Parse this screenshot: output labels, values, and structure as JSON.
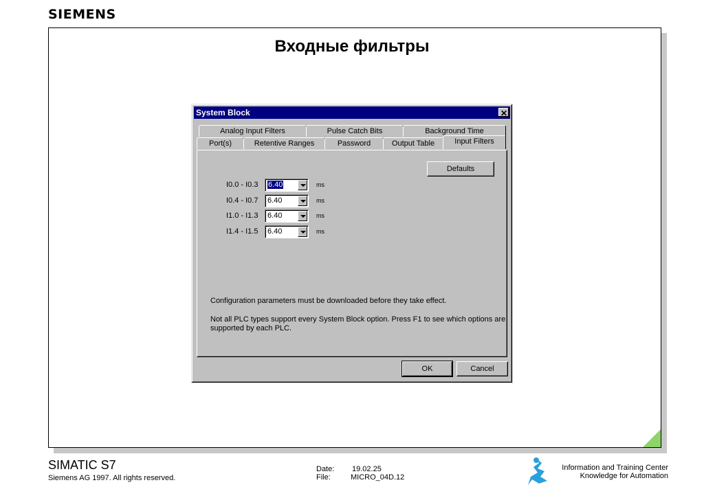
{
  "brand": "SIEMENS",
  "slide_title": "Входные фильтры",
  "dialog": {
    "title": "System Block",
    "close_glyph": "✕",
    "tabs_back": [
      "Analog Input Filters",
      "Pulse Catch Bits",
      "Background Time"
    ],
    "tabs_front": [
      "Port(s)",
      "Retentive Ranges",
      "Password",
      "Output Table",
      "Input Filters"
    ],
    "defaults_label": "Defaults",
    "rows": [
      {
        "label": "I0.0 - I0.3",
        "value": "6.40",
        "unit": "ms"
      },
      {
        "label": "I0.4 - I0.7",
        "value": "6.40",
        "unit": "ms"
      },
      {
        "label": "I1.0 - I1.3",
        "value": "6.40",
        "unit": "ms"
      },
      {
        "label": "I1.4 - I1.5",
        "value": "6.40",
        "unit": "ms"
      }
    ],
    "note1": "Configuration parameters must be downloaded before they take effect.",
    "note2a": "Not all PLC types support every System Block option.  Press F1 to see which options are",
    "note2b": "supported by each PLC.",
    "ok_label": "OK",
    "cancel_label": "Cancel"
  },
  "footer": {
    "product": "SIMATIC S7",
    "copyright": "Siemens AG 1997. All rights reserved.",
    "date_label": "Date:",
    "date_value": "19.02.25",
    "file_label": "File:",
    "file_value": "MICRO_04D.12",
    "center_line1": "Information and Training Center",
    "center_line2": "Knowledge for Automation"
  },
  "colors": {
    "accent_corner": "#8fd46a",
    "titlebar": "#000080",
    "dialog_face": "#c0c0c0"
  }
}
